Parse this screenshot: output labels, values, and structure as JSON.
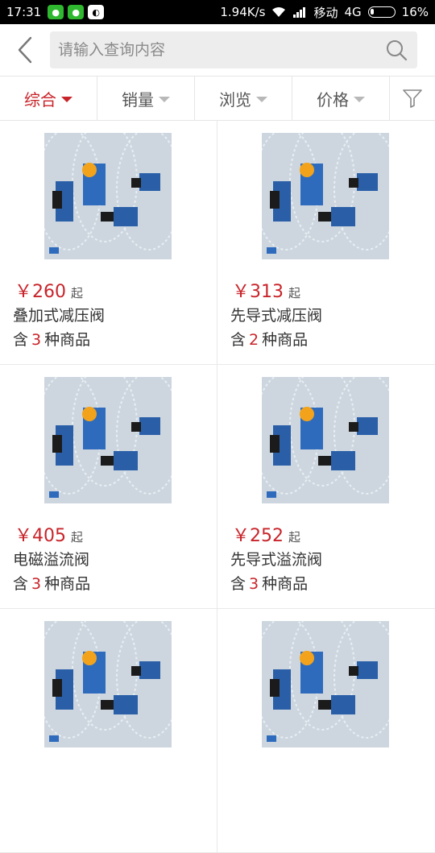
{
  "status_bar": {
    "time": "17:31",
    "speed": "1.94K/s",
    "carrier": "移动",
    "network": "4G",
    "battery": "16%",
    "battery_level": 0.16
  },
  "search": {
    "placeholder": "请输入查询内容"
  },
  "filters": [
    {
      "label": "综合",
      "active": true
    },
    {
      "label": "销量",
      "active": false
    },
    {
      "label": "浏览",
      "active": false
    },
    {
      "label": "价格",
      "active": false
    }
  ],
  "products": [
    {
      "price": "￥260",
      "suffix": "起",
      "name": "叠加式减压阀",
      "count_prefix": "含",
      "count": "3",
      "count_suffix": "种商品"
    },
    {
      "price": "￥313",
      "suffix": "起",
      "name": "先导式减压阀",
      "count_prefix": "含",
      "count": "2",
      "count_suffix": "种商品"
    },
    {
      "price": "￥405",
      "suffix": "起",
      "name": "电磁溢流阀",
      "count_prefix": "含",
      "count": "3",
      "count_suffix": "种商品"
    },
    {
      "price": "￥252",
      "suffix": "起",
      "name": "先导式溢流阀",
      "count_prefix": "含",
      "count": "3",
      "count_suffix": "种商品"
    },
    {
      "price": "",
      "suffix": "",
      "name": "",
      "count_prefix": "",
      "count": "",
      "count_suffix": ""
    },
    {
      "price": "",
      "suffix": "",
      "name": "",
      "count_prefix": "",
      "count": "",
      "count_suffix": ""
    }
  ],
  "colors": {
    "accent": "#c8242a",
    "statusbar": "#000000",
    "search_bg": "#ededed"
  }
}
